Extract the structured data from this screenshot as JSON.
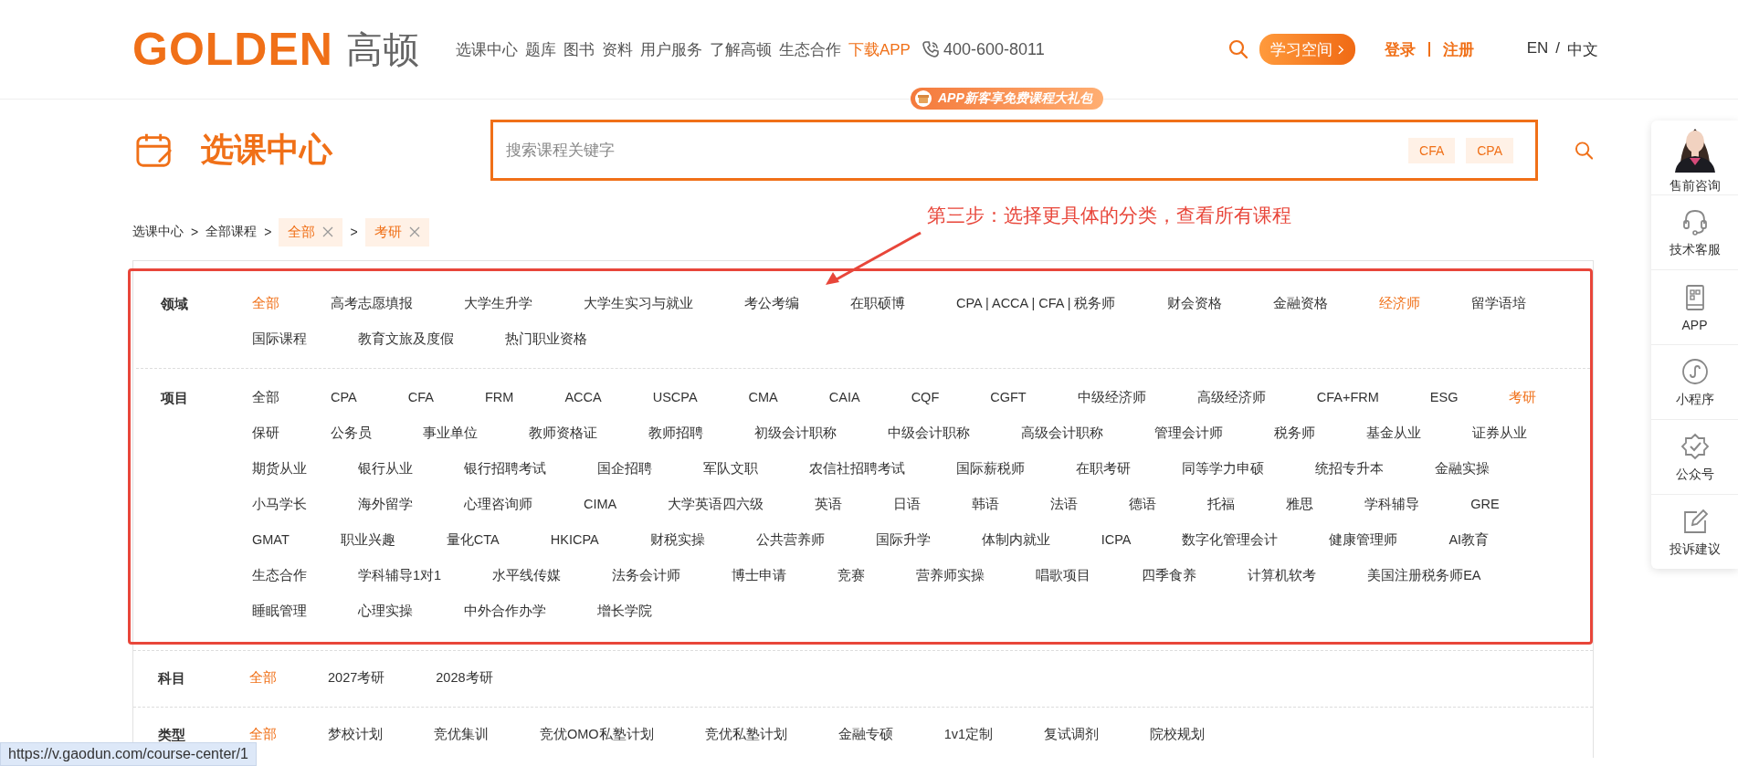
{
  "header": {
    "logo": "GOLDEN",
    "logo_cn": "高顿",
    "nav": [
      {
        "label": "选课中心",
        "highlighted": false
      },
      {
        "label": "题库",
        "highlighted": false
      },
      {
        "label": "图书",
        "highlighted": false
      },
      {
        "label": "资料",
        "highlighted": false
      },
      {
        "label": "用户服务",
        "highlighted": false
      },
      {
        "label": "了解高顿",
        "highlighted": false
      },
      {
        "label": "生态合作",
        "highlighted": false
      },
      {
        "label": "下载APP",
        "highlighted": true
      }
    ],
    "phone": "400-600-8011",
    "study_button": "学习空间",
    "login": "登录",
    "register": "注册",
    "lang": {
      "options": [
        "EN",
        "中文"
      ],
      "separator": "/"
    },
    "promo": "APP新客享免费课程大礼包"
  },
  "page_title": "选课中心",
  "search": {
    "placeholder": "搜索课程关键字",
    "tags": [
      "CFA",
      "CPA"
    ]
  },
  "breadcrumb": {
    "items": [
      "选课中心",
      "全部课程"
    ],
    "separator": ">",
    "tags": [
      "全部",
      "考研"
    ]
  },
  "annotation": "第三步：选择更具体的分类，查看所有课程",
  "filters": [
    {
      "label": "领域",
      "framed": true,
      "options": [
        {
          "label": "全部",
          "selected": true
        },
        {
          "label": "高考志愿填报",
          "selected": false
        },
        {
          "label": "大学生升学",
          "selected": false
        },
        {
          "label": "大学生实习与就业",
          "selected": false
        },
        {
          "label": "考公考编",
          "selected": false
        },
        {
          "label": "在职硕博",
          "selected": false
        },
        {
          "label": "CPA | ACCA | CFA | 税务师",
          "selected": false
        },
        {
          "label": "财会资格",
          "selected": false
        },
        {
          "label": "金融资格",
          "selected": false
        },
        {
          "label": "经济师",
          "selected": true
        },
        {
          "label": "留学语培",
          "selected": false
        },
        {
          "label": "国际课程",
          "selected": false
        },
        {
          "label": "教育文旅及度假",
          "selected": false
        },
        {
          "label": "热门职业资格",
          "selected": false
        }
      ]
    },
    {
      "label": "项目",
      "framed": true,
      "options": [
        {
          "label": "全部",
          "selected": false
        },
        {
          "label": "CPA",
          "selected": false
        },
        {
          "label": "CFA",
          "selected": false
        },
        {
          "label": "FRM",
          "selected": false
        },
        {
          "label": "ACCA",
          "selected": false
        },
        {
          "label": "USCPA",
          "selected": false
        },
        {
          "label": "CMA",
          "selected": false
        },
        {
          "label": "CAIA",
          "selected": false
        },
        {
          "label": "CQF",
          "selected": false
        },
        {
          "label": "CGFT",
          "selected": false
        },
        {
          "label": "中级经济师",
          "selected": false
        },
        {
          "label": "高级经济师",
          "selected": false
        },
        {
          "label": "CFA+FRM",
          "selected": false
        },
        {
          "label": "ESG",
          "selected": false
        },
        {
          "label": "考研",
          "selected": true
        },
        {
          "label": "保研",
          "selected": false
        },
        {
          "label": "公务员",
          "selected": false
        },
        {
          "label": "事业单位",
          "selected": false
        },
        {
          "label": "教师资格证",
          "selected": false
        },
        {
          "label": "教师招聘",
          "selected": false
        },
        {
          "label": "初级会计职称",
          "selected": false
        },
        {
          "label": "中级会计职称",
          "selected": false
        },
        {
          "label": "高级会计职称",
          "selected": false
        },
        {
          "label": "管理会计师",
          "selected": false
        },
        {
          "label": "税务师",
          "selected": false
        },
        {
          "label": "基金从业",
          "selected": false
        },
        {
          "label": "证券从业",
          "selected": false
        },
        {
          "label": "期货从业",
          "selected": false
        },
        {
          "label": "银行从业",
          "selected": false
        },
        {
          "label": "银行招聘考试",
          "selected": false
        },
        {
          "label": "国企招聘",
          "selected": false
        },
        {
          "label": "军队文职",
          "selected": false
        },
        {
          "label": "农信社招聘考试",
          "selected": false
        },
        {
          "label": "国际薪税师",
          "selected": false
        },
        {
          "label": "在职考研",
          "selected": false
        },
        {
          "label": "同等学力申硕",
          "selected": false
        },
        {
          "label": "统招专升本",
          "selected": false
        },
        {
          "label": "金融实操",
          "selected": false
        },
        {
          "label": "小马学长",
          "selected": false
        },
        {
          "label": "海外留学",
          "selected": false
        },
        {
          "label": "心理咨询师",
          "selected": false
        },
        {
          "label": "CIMA",
          "selected": false
        },
        {
          "label": "大学英语四六级",
          "selected": false
        },
        {
          "label": "英语",
          "selected": false
        },
        {
          "label": "日语",
          "selected": false
        },
        {
          "label": "韩语",
          "selected": false
        },
        {
          "label": "法语",
          "selected": false
        },
        {
          "label": "德语",
          "selected": false
        },
        {
          "label": "托福",
          "selected": false
        },
        {
          "label": "雅思",
          "selected": false
        },
        {
          "label": "学科辅导",
          "selected": false
        },
        {
          "label": "GRE",
          "selected": false
        },
        {
          "label": "GMAT",
          "selected": false
        },
        {
          "label": "职业兴趣",
          "selected": false
        },
        {
          "label": "量化CTA",
          "selected": false
        },
        {
          "label": "HKICPA",
          "selected": false
        },
        {
          "label": "财税实操",
          "selected": false
        },
        {
          "label": "公共营养师",
          "selected": false
        },
        {
          "label": "国际升学",
          "selected": false
        },
        {
          "label": "体制内就业",
          "selected": false
        },
        {
          "label": "ICPA",
          "selected": false
        },
        {
          "label": "数字化管理会计",
          "selected": false
        },
        {
          "label": "健康管理师",
          "selected": false
        },
        {
          "label": "AI教育",
          "selected": false
        },
        {
          "label": "生态合作",
          "selected": false
        },
        {
          "label": "学科辅导1对1",
          "selected": false
        },
        {
          "label": "水平线传媒",
          "selected": false
        },
        {
          "label": "法务会计师",
          "selected": false
        },
        {
          "label": "博士申请",
          "selected": false
        },
        {
          "label": "竞赛",
          "selected": false
        },
        {
          "label": "营养师实操",
          "selected": false
        },
        {
          "label": "唱歌项目",
          "selected": false
        },
        {
          "label": "四季食养",
          "selected": false
        },
        {
          "label": "计算机软考",
          "selected": false
        },
        {
          "label": "美国注册税务师EA",
          "selected": false
        },
        {
          "label": "睡眠管理",
          "selected": false
        },
        {
          "label": "心理实操",
          "selected": false
        },
        {
          "label": "中外合作办学",
          "selected": false
        },
        {
          "label": "增长学院",
          "selected": false
        }
      ]
    },
    {
      "label": "科目",
      "framed": false,
      "options": [
        {
          "label": "全部",
          "selected": true
        },
        {
          "label": "2027考研",
          "selected": false
        },
        {
          "label": "2028考研",
          "selected": false
        }
      ]
    },
    {
      "label": "类型",
      "framed": false,
      "options": [
        {
          "label": "全部",
          "selected": true
        },
        {
          "label": "梦校计划",
          "selected": false
        },
        {
          "label": "竞优集训",
          "selected": false
        },
        {
          "label": "竞优OMO私塾计划",
          "selected": false
        },
        {
          "label": "竞优私塾计划",
          "selected": false
        },
        {
          "label": "金融专硕",
          "selected": false
        },
        {
          "label": "1v1定制",
          "selected": false
        },
        {
          "label": "复试调剂",
          "selected": false
        },
        {
          "label": "院校规划",
          "selected": false
        }
      ]
    }
  ],
  "sidebar": [
    {
      "label": "售前咨询"
    },
    {
      "label": "技术客服",
      "kind": "headset"
    },
    {
      "label": "APP",
      "kind": "app"
    },
    {
      "label": "小程序",
      "kind": "miniprogram"
    },
    {
      "label": "公众号",
      "kind": "badge"
    },
    {
      "label": "投诉建议",
      "kind": "edit"
    }
  ],
  "status_url": "https://v.gaodun.com/course-center/1"
}
